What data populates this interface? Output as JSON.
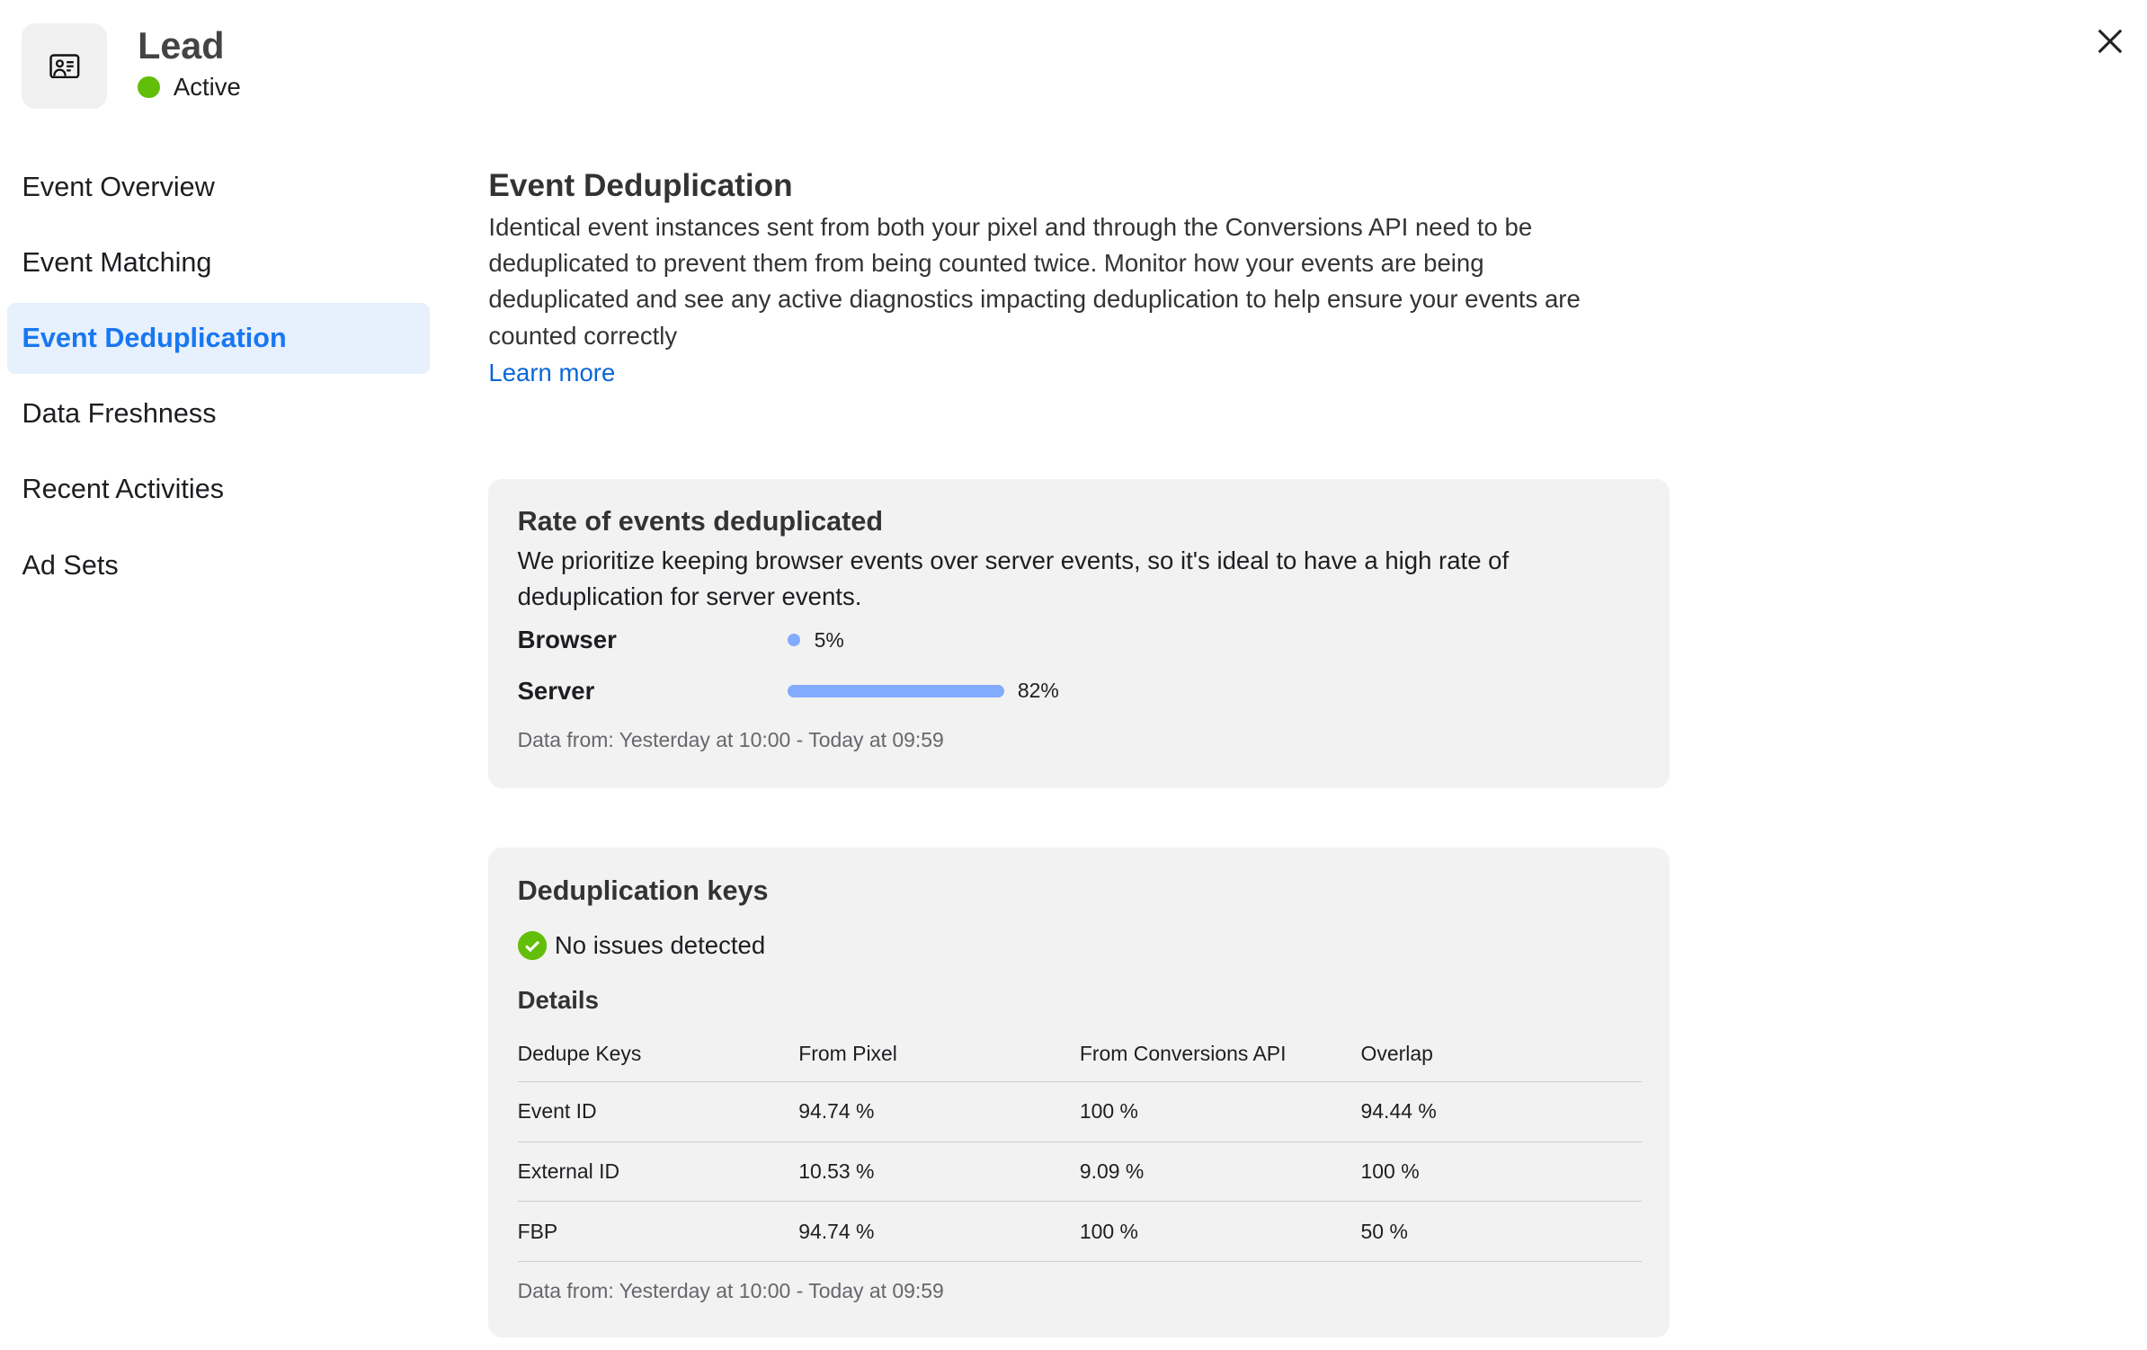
{
  "header": {
    "title": "Lead",
    "status": "Active",
    "status_color": "#63be09",
    "icon": "contact-card-icon",
    "close_icon": "close-icon"
  },
  "sidebar": {
    "items": [
      {
        "label": "Event Overview"
      },
      {
        "label": "Event Matching"
      },
      {
        "label": "Event Deduplication",
        "selected": true
      },
      {
        "label": "Data Freshness"
      },
      {
        "label": "Recent Activities"
      },
      {
        "label": "Ad Sets"
      }
    ]
  },
  "main": {
    "title": "Event Deduplication",
    "description": "Identical event instances sent from both your pixel and through the Conversions API need to be deduplicated to prevent them from being counted twice. Monitor how your events are being deduplicated and see any active diagnostics impacting deduplication to help ensure your events are counted correctly",
    "learn_more": "Learn more"
  },
  "rate_card": {
    "title": "Rate of events deduplicated",
    "description": "We prioritize keeping browser events over server events, so it's ideal to have a high rate of deduplication for server events.",
    "rows": [
      {
        "label": "Browser",
        "value": 5,
        "text": "5%"
      },
      {
        "label": "Server",
        "value": 82,
        "text": "82%"
      }
    ],
    "bar_color": "#82aafd",
    "footer": "Data from: Yesterday at 10:00 - Today at 09:59"
  },
  "keys_card": {
    "title": "Deduplication keys",
    "status": "No issues detected",
    "details": "Details",
    "columns": [
      "Dedupe Keys",
      "From Pixel",
      "From Conversions API",
      "Overlap"
    ],
    "rows": [
      [
        "Event ID",
        "94.74 %",
        "100 %",
        "94.44 %"
      ],
      [
        "External ID",
        "10.53 %",
        "9.09 %",
        "100 %"
      ],
      [
        "FBP",
        "94.74 %",
        "100 %",
        "50 %"
      ]
    ],
    "footer": "Data from: Yesterday at 10:00 - Today at 09:59"
  }
}
